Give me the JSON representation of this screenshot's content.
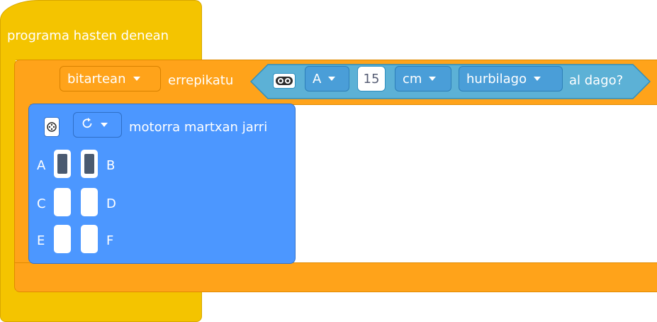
{
  "hat": {
    "label": "programa hasten denean"
  },
  "loop": {
    "mode_dropdown": "bitartean",
    "label": "errepikatu"
  },
  "sensor": {
    "icon": "distance-sensor-icon",
    "port": "A",
    "value": "15",
    "unit": "cm",
    "comparison": "hurbilago",
    "suffix": "al dago?"
  },
  "motor": {
    "icon": "motor-hub-icon",
    "direction_icon": "clockwise-rotate-icon",
    "label": "motorra martxan jarri",
    "ports": [
      {
        "left": "A",
        "right": "B",
        "left_selected": true,
        "right_selected": true
      },
      {
        "left": "C",
        "right": "D",
        "left_selected": false,
        "right_selected": false
      },
      {
        "left": "E",
        "right": "F",
        "left_selected": false,
        "right_selected": false
      }
    ]
  },
  "colors": {
    "hat": "#f4c400",
    "loop": "#ffa31a",
    "motor": "#4c97ff",
    "sensor": "#5cb1d6",
    "selected_port": "#4a5a70"
  }
}
